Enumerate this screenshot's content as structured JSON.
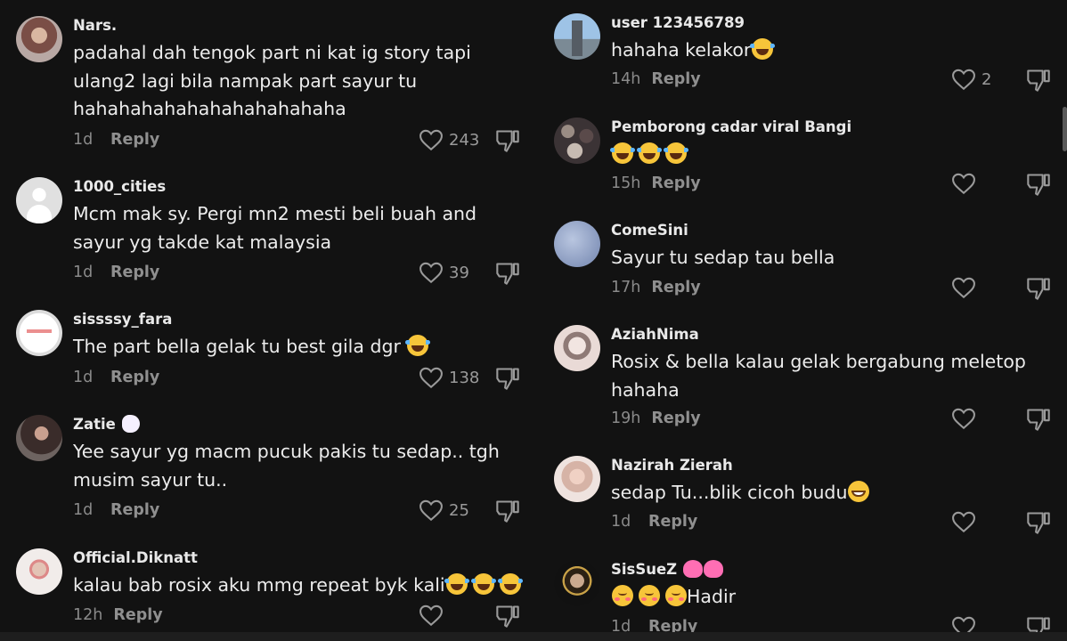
{
  "left_comments": [
    {
      "username": "Nars.",
      "lines": [
        "padahal dah tengok part ni kat ig story tapi",
        "ulang2 lagi bila nampak part sayur tu",
        "hahahahahahahahahahahaha"
      ],
      "time": "1d",
      "reply": "Reply",
      "likes": "243"
    },
    {
      "username": "1000_cities",
      "lines": [
        "Mcm mak sy. Pergi mn2 mesti beli buah and",
        "sayur yg takde kat malaysia"
      ],
      "time": "1d",
      "reply": "Reply",
      "likes": "39"
    },
    {
      "username": "sissssy_fara",
      "lines": [
        "The part bella gelak tu best gila dgr"
      ],
      "time": "1d",
      "reply": "Reply",
      "likes": "138"
    },
    {
      "username": "Zatie",
      "lines": [
        "Yee sayur yg macm pucuk pakis tu sedap.. tgh",
        "musim sayur tu.."
      ],
      "time": "1d",
      "reply": "Reply",
      "likes": "25"
    },
    {
      "username": "Official.Diknatt",
      "lines": [
        "kalau bab rosix aku mmg repeat byk kali"
      ],
      "time": "12h",
      "reply": "Reply",
      "likes": ""
    }
  ],
  "right_comments": [
    {
      "username": "user 123456789",
      "lines": [
        "hahaha kelakor"
      ],
      "time": "14h",
      "reply": "Reply",
      "likes": "2"
    },
    {
      "username": "Pemborong cadar viral Bangi",
      "lines": [
        ""
      ],
      "time": "15h",
      "reply": "Reply",
      "likes": ""
    },
    {
      "username": "ComeSini",
      "lines": [
        "Sayur tu sedap tau bella"
      ],
      "time": "17h",
      "reply": "Reply",
      "likes": ""
    },
    {
      "username": "AziahNima",
      "lines": [
        "Rosix & bella kalau gelak bergabung meletop",
        "hahaha"
      ],
      "time": "19h",
      "reply": "Reply",
      "likes": ""
    },
    {
      "username": "Nazirah Zierah",
      "lines": [
        "sedap Tu...blik cicoh budu"
      ],
      "time": "1d",
      "reply": "Reply",
      "likes": ""
    },
    {
      "username": "SisSueZ",
      "lines": [
        "Hadir"
      ],
      "time": "1d",
      "reply": "Reply",
      "likes": ""
    }
  ],
  "icons": {
    "like": "heart-outline-icon",
    "dislike": "thumbs-down-icon",
    "laugh": "face-with-tears-of-joy-emoji",
    "grin": "grinning-face-emoji",
    "love": "smiling-face-with-hearts-emoji",
    "unicorn": "unicorn-emoji",
    "heart": "sparkling-heart-emoji"
  },
  "colors": {
    "background": "#121212",
    "username": "#e9e9e9",
    "text": "#ececec",
    "meta": "#8a8a8a"
  }
}
